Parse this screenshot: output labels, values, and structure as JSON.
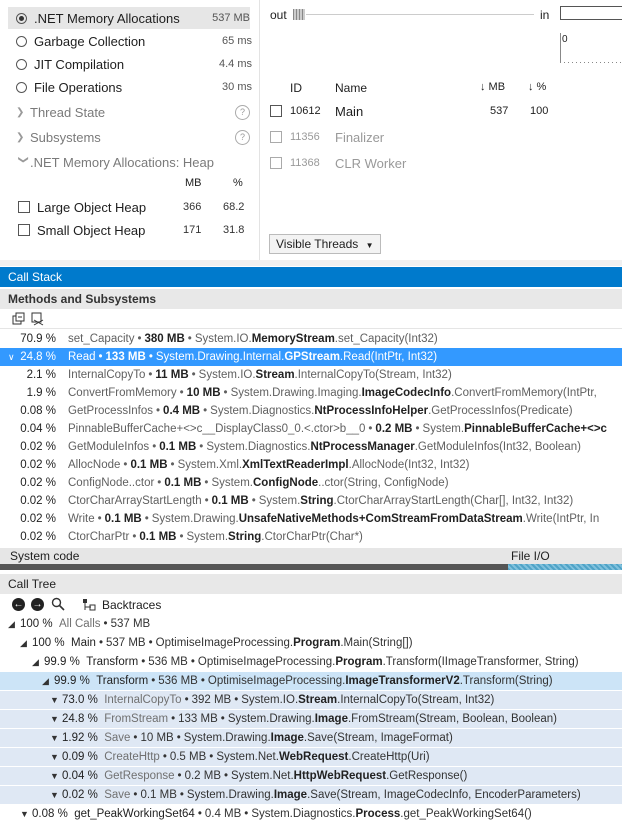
{
  "tools": [
    {
      "label": ".NET Memory Allocations",
      "value": "537 MB",
      "selected": true
    },
    {
      "label": "Garbage Collection",
      "value": "65 ms"
    },
    {
      "label": "JIT Compilation",
      "value": "4.4 ms"
    },
    {
      "label": "File Operations",
      "value": "30 ms"
    }
  ],
  "collapsed": [
    {
      "label": "Thread State",
      "help": "?"
    },
    {
      "label": "Subsystems",
      "help": "?"
    }
  ],
  "heap": {
    "title": ".NET Memory Allocations: Heap",
    "col_mb": "MB",
    "col_pct": "%",
    "rows": [
      {
        "label": "Large Object Heap",
        "mb": "366",
        "pct": "68.2"
      },
      {
        "label": "Small Object Heap",
        "mb": "171",
        "pct": "31.8"
      }
    ]
  },
  "timeline": {
    "out": "out",
    "in": "in",
    "zero": "0"
  },
  "threads": {
    "headers": {
      "id": "ID",
      "name": "Name",
      "mb": "↓ MB",
      "pct": "↓ %"
    },
    "rows": [
      {
        "id": "10612",
        "name": "Main",
        "mb": "537",
        "pct": "100"
      },
      {
        "id": "11356",
        "name": "Finalizer",
        "mb": "",
        "pct": ""
      },
      {
        "id": "11368",
        "name": "CLR Worker",
        "mb": "",
        "pct": ""
      }
    ],
    "visible_threads": "Visible Threads"
  },
  "call_stack": {
    "title": "Call Stack",
    "subtitle": "Methods and Subsystems",
    "rows": [
      {
        "pct": "70.9 %",
        "name": "set_Capacity",
        "size": "380 MB",
        "pre": "System.IO.",
        "bold": "MemoryStream",
        "post": ".set_Capacity(Int32)"
      },
      {
        "pct": "24.8 %",
        "name": "Read",
        "size": "133 MB",
        "pre": "System.Drawing.Internal.",
        "bold": "GPStream",
        "post": ".Read(IntPtr, Int32)"
      },
      {
        "pct": "2.1 %",
        "name": "InternalCopyTo",
        "size": "11 MB",
        "pre": "System.IO.",
        "bold": "Stream",
        "post": ".InternalCopyTo(Stream, Int32)"
      },
      {
        "pct": "1.9 %",
        "name": "ConvertFromMemory",
        "size": "10 MB",
        "pre": "System.Drawing.Imaging.",
        "bold": "ImageCodecInfo",
        "post": ".ConvertFromMemory(IntPtr,"
      },
      {
        "pct": "0.08 %",
        "name": "GetProcessInfos",
        "size": "0.4 MB",
        "pre": "System.Diagnostics.",
        "bold": "NtProcessInfoHelper",
        "post": ".GetProcessInfos(Predicate)"
      },
      {
        "pct": "0.04 %",
        "name": "PinnableBufferCache+<>c__DisplayClass0_0.<.ctor>b__0",
        "size": "0.2 MB",
        "pre": "System.",
        "bold": "PinnableBufferCache+<>c",
        "post": ""
      },
      {
        "pct": "0.02 %",
        "name": "GetModuleInfos",
        "size": "0.1 MB",
        "pre": "System.Diagnostics.",
        "bold": "NtProcessManager",
        "post": ".GetModuleInfos(Int32, Boolean)"
      },
      {
        "pct": "0.02 %",
        "name": "AllocNode",
        "size": "0.1 MB",
        "pre": "System.Xml.",
        "bold": "XmlTextReaderImpl",
        "post": ".AllocNode(Int32, Int32)"
      },
      {
        "pct": "0.02 %",
        "name": "ConfigNode..ctor",
        "size": "0.1 MB",
        "pre": "System.",
        "bold": "ConfigNode",
        "post": "..ctor(String, ConfigNode)"
      },
      {
        "pct": "0.02 %",
        "name": "CtorCharArrayStartLength",
        "size": "0.1 MB",
        "pre": "System.",
        "bold": "String",
        "post": ".CtorCharArrayStartLength(Char[], Int32, Int32)"
      },
      {
        "pct": "0.02 %",
        "name": "Write",
        "size": "0.1 MB",
        "pre": "System.Drawing.",
        "bold": "UnsafeNativeMethods+ComStreamFromDataStream",
        "post": ".Write(IntPtr, In"
      },
      {
        "pct": "0.02 %",
        "name": "CtorCharPtr",
        "size": "0.1 MB",
        "pre": "System.",
        "bold": "String",
        "post": ".CtorCharPtr(Char*)"
      }
    ],
    "legend_left": "System code",
    "legend_right": "File I/O"
  },
  "call_tree": {
    "title": "Call Tree",
    "backtraces": "Backtraces",
    "rows": [
      {
        "pct": "100 %",
        "name": "All Calls",
        "size": "537 MB",
        "pre": "",
        "bold": "",
        "post": ""
      },
      {
        "pct": "100 %",
        "name": "Main",
        "size": "537 MB",
        "pre": "OptimiseImageProcessing.",
        "bold": "Program",
        "post": ".Main(String[])"
      },
      {
        "pct": "99.9 %",
        "name": "Transform",
        "size": "536 MB",
        "pre": "OptimiseImageProcessing.",
        "bold": "Program",
        "post": ".Transform(IImageTransformer, String)"
      },
      {
        "pct": "99.9 %",
        "name": "Transform",
        "size": "536 MB",
        "pre": "OptimiseImageProcessing.",
        "bold": "ImageTransformerV2",
        "post": ".Transform(String)"
      },
      {
        "pct": "73.0 %",
        "name": "InternalCopyTo",
        "size": "392 MB",
        "pre": "System.IO.",
        "bold": "Stream",
        "post": ".InternalCopyTo(Stream, Int32)"
      },
      {
        "pct": "24.8 %",
        "name": "FromStream",
        "size": "133 MB",
        "pre": "System.Drawing.",
        "bold": "Image",
        "post": ".FromStream(Stream, Boolean, Boolean)"
      },
      {
        "pct": "1.92 %",
        "name": "Save",
        "size": "10 MB",
        "pre": "System.Drawing.",
        "bold": "Image",
        "post": ".Save(Stream, ImageFormat)"
      },
      {
        "pct": "0.09 %",
        "name": "CreateHttp",
        "size": "0.5 MB",
        "pre": "System.Net.",
        "bold": "WebRequest",
        "post": ".CreateHttp(Uri)"
      },
      {
        "pct": "0.04 %",
        "name": "GetResponse",
        "size": "0.2 MB",
        "pre": "System.Net.",
        "bold": "HttpWebRequest",
        "post": ".GetResponse()"
      },
      {
        "pct": "0.02 %",
        "name": "Save",
        "size": "0.1 MB",
        "pre": "System.Drawing.",
        "bold": "Image",
        "post": ".Save(Stream, ImageCodecInfo, EncoderParameters)"
      },
      {
        "pct": "0.08 %",
        "name": "get_PeakWorkingSet64",
        "size": "0.4 MB",
        "pre": "System.Diagnostics.",
        "bold": "Process",
        "post": ".get_PeakWorkingSet64()"
      }
    ]
  },
  "colors": {
    "accent": "#007acc",
    "selection": "#3399ff",
    "tree_selection": "#cce4f7",
    "system_bar": "#555555",
    "fileio_bar": "#4fa3c7"
  }
}
